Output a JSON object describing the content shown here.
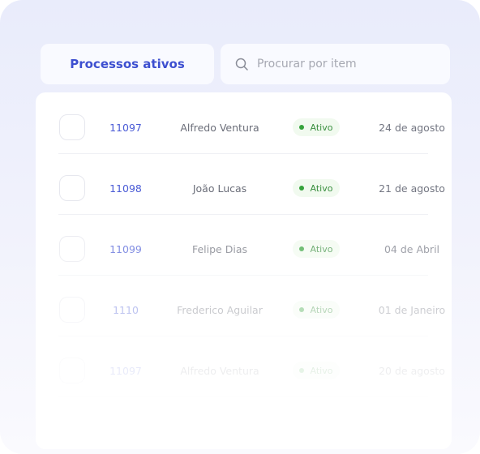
{
  "tabs": {
    "active_label": "Processos ativos"
  },
  "search": {
    "placeholder": "Procurar por item",
    "icon": "search-icon"
  },
  "colors": {
    "accent": "#3d4fd0",
    "status_active": "#35a33b",
    "status_active_bg": "#f1faef"
  },
  "rows": [
    {
      "id": "11097",
      "name": "Alfredo Ventura",
      "status": "Ativo",
      "date": "24 de agosto"
    },
    {
      "id": "11098",
      "name": "João Lucas",
      "status": "Ativo",
      "date": "21 de agosto"
    },
    {
      "id": "11099",
      "name": "Felipe Dias",
      "status": "Ativo",
      "date": "04 de Abril"
    },
    {
      "id": "1110",
      "name": "Frederico Aguilar",
      "status": "Ativo",
      "date": "01  de Janeiro"
    },
    {
      "id": "11097",
      "name": "Alfredo Ventura",
      "status": "Ativo",
      "date": "20 de agosto"
    }
  ]
}
